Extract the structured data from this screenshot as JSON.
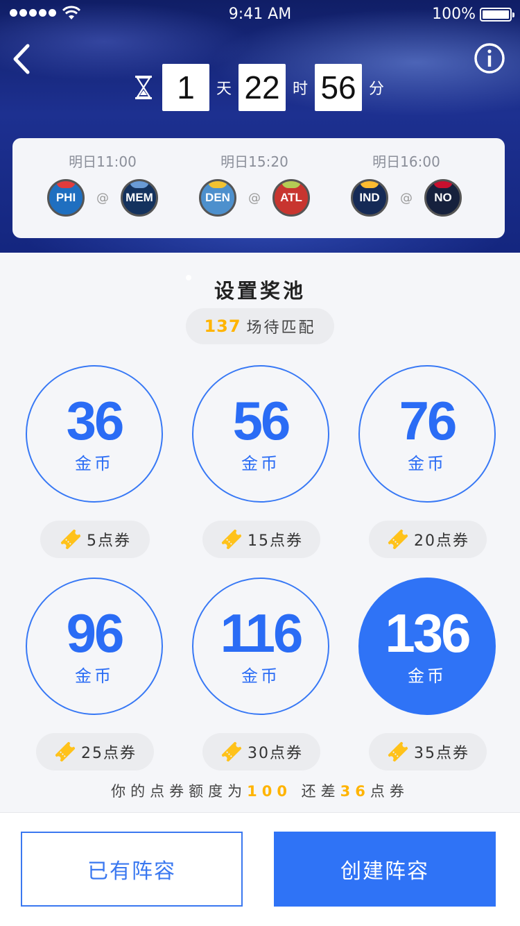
{
  "status_bar": {
    "time": "9:41 AM",
    "battery": "100%"
  },
  "header": {
    "countdown": [
      {
        "value": "1",
        "unit": "天"
      },
      {
        "value": "22",
        "unit": "时"
      },
      {
        "value": "56",
        "unit": "分"
      }
    ]
  },
  "matches": [
    {
      "time": "明日11:00",
      "home": "PHI",
      "away": "MEM",
      "at": "@"
    },
    {
      "time": "明日15:20",
      "home": "DEN",
      "away": "ATL",
      "at": "@"
    },
    {
      "time": "明日16:00",
      "home": "IND",
      "away": "NO",
      "at": "@"
    }
  ],
  "team_colors": {
    "PHI": {
      "bg": "#1f6fc0",
      "collar": "#e23c3c"
    },
    "MEM": {
      "bg": "#14325e",
      "collar": "#6a9bd6"
    },
    "DEN": {
      "bg": "#4d90cd",
      "collar": "#f2c230"
    },
    "ATL": {
      "bg": "#c8352f",
      "collar": "#b4cc55"
    },
    "IND": {
      "bg": "#152a56",
      "collar": "#fdbb30"
    },
    "NO": {
      "bg": "#16213d",
      "collar": "#c8102e"
    }
  },
  "prize_pool": {
    "title": "设置奖池",
    "pending_count": "137",
    "pending_label": "场待匹配",
    "options": [
      {
        "amount": "36",
        "unit": "金币",
        "ticket": "5点券",
        "selected": false
      },
      {
        "amount": "56",
        "unit": "金币",
        "ticket": "15点券",
        "selected": false
      },
      {
        "amount": "76",
        "unit": "金币",
        "ticket": "20点券",
        "selected": false
      },
      {
        "amount": "96",
        "unit": "金币",
        "ticket": "25点券",
        "selected": false
      },
      {
        "amount": "116",
        "unit": "金币",
        "ticket": "30点券",
        "selected": false
      },
      {
        "amount": "136",
        "unit": "金币",
        "ticket": "35点券",
        "selected": true
      }
    ]
  },
  "quota": {
    "prefix": "你的点券额度为",
    "amount": "100",
    "middle": "还差",
    "missing": "36",
    "suffix": "点券"
  },
  "buttons": {
    "existing_lineup": "已有阵容",
    "create_lineup": "创建阵容"
  },
  "colors": {
    "accent": "#2f73f6",
    "highlight": "#ffb400"
  }
}
